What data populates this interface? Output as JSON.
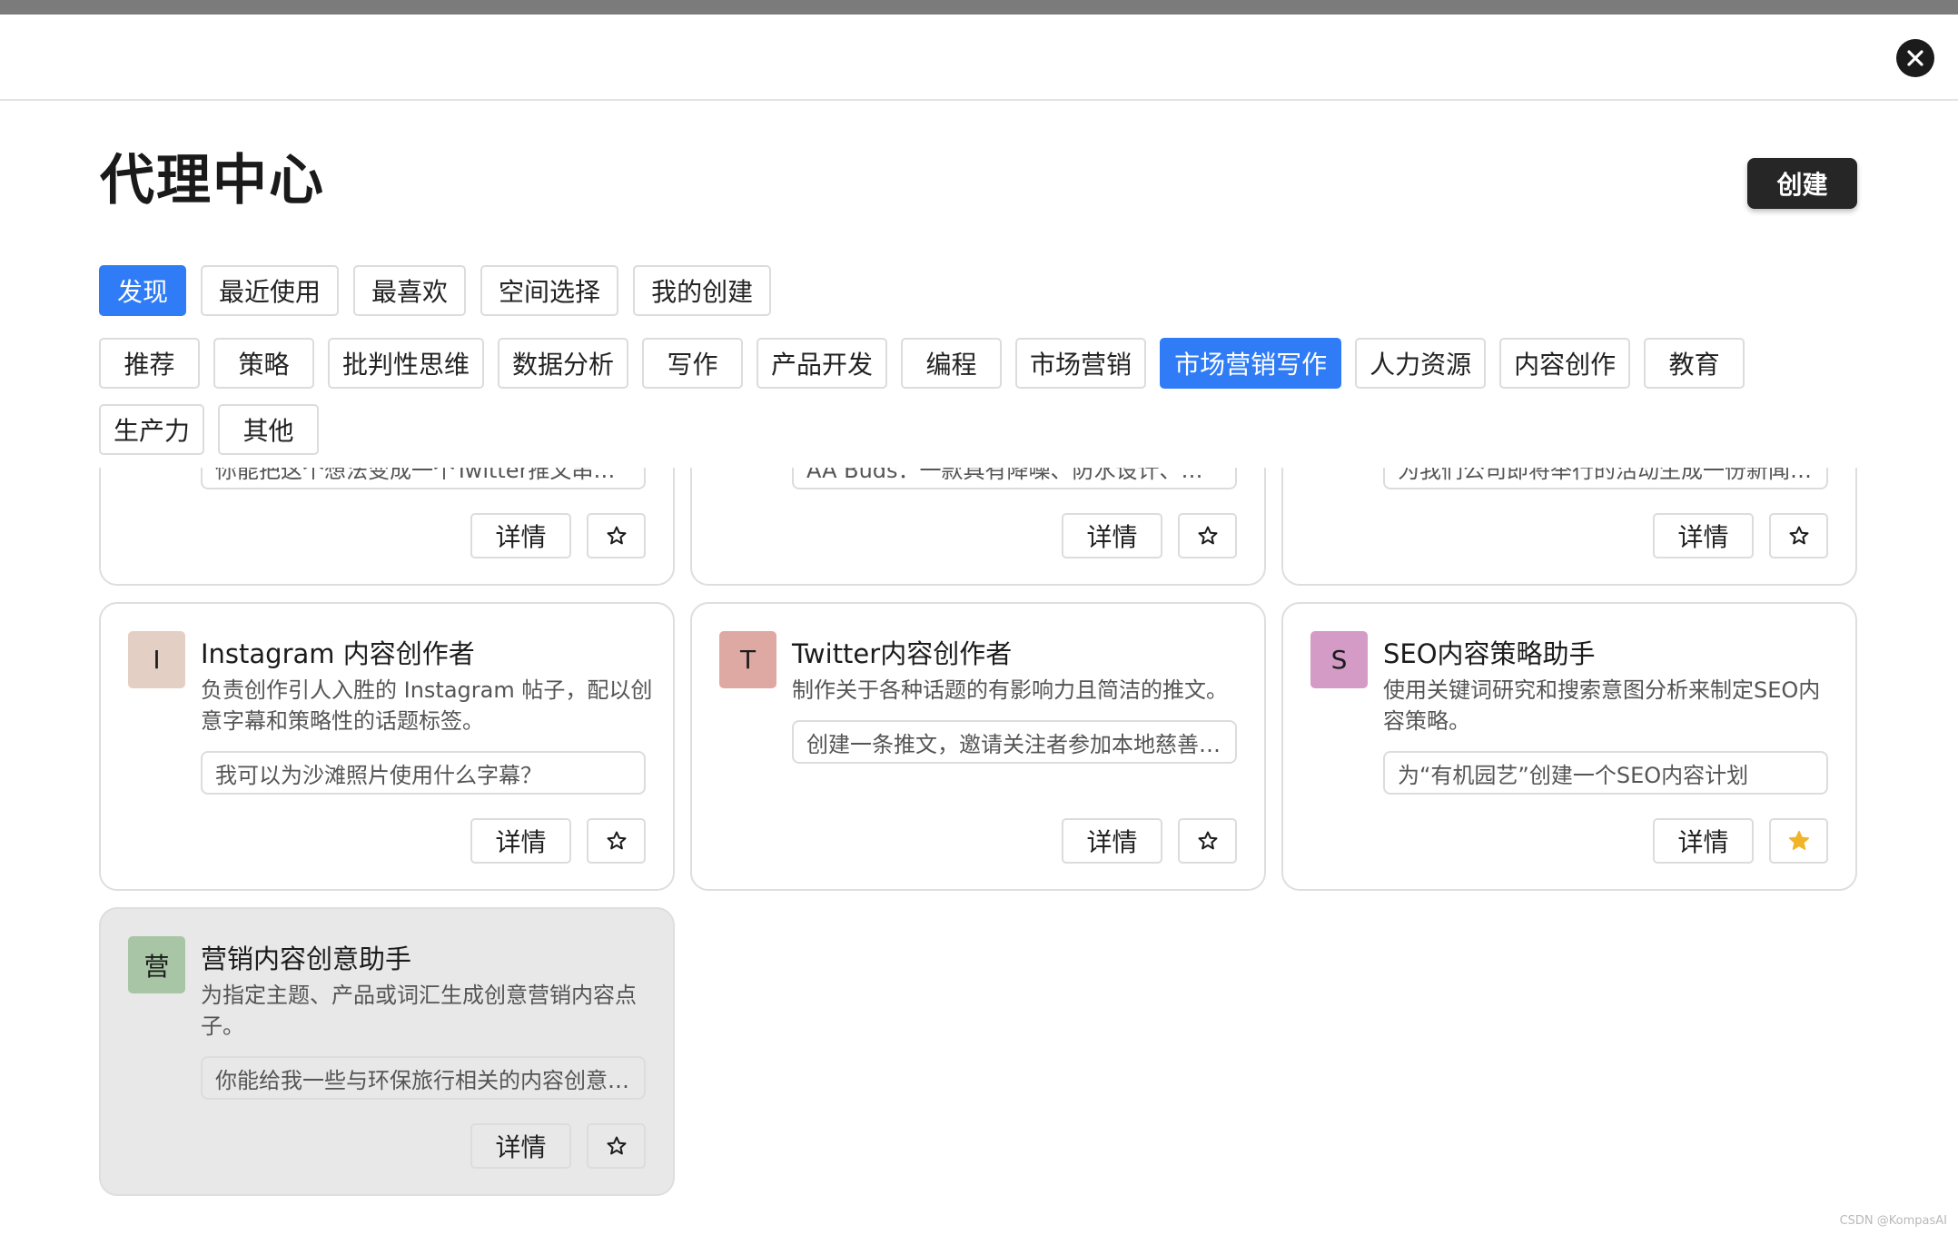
{
  "header": {
    "close_icon": "close-icon"
  },
  "page": {
    "title": "代理中心",
    "create_label": "创建"
  },
  "tabs": [
    {
      "label": "发现",
      "active": true
    },
    {
      "label": "最近使用",
      "active": false
    },
    {
      "label": "最喜欢",
      "active": false
    },
    {
      "label": "空间选择",
      "active": false
    },
    {
      "label": "我的创建",
      "active": false
    }
  ],
  "categories": [
    {
      "label": "推荐",
      "active": false
    },
    {
      "label": "策略",
      "active": false
    },
    {
      "label": "批判性思维",
      "active": false
    },
    {
      "label": "数据分析",
      "active": false
    },
    {
      "label": "写作",
      "active": false
    },
    {
      "label": "产品开发",
      "active": false
    },
    {
      "label": "编程",
      "active": false
    },
    {
      "label": "市场营销",
      "active": false
    },
    {
      "label": "市场营销写作",
      "active": true
    },
    {
      "label": "人力资源",
      "active": false
    },
    {
      "label": "内容创作",
      "active": false
    },
    {
      "label": "教育",
      "active": false
    },
    {
      "label": "生产力",
      "active": false
    },
    {
      "label": "其他",
      "active": false
    }
  ],
  "partial_cards": [
    {
      "prompt": "你能把这个想法变成一个Twitter推文串…",
      "details_label": "详情",
      "starred": false
    },
    {
      "prompt": "AA Buds：一款具有降噪、防水设计、高…",
      "details_label": "详情",
      "starred": false
    },
    {
      "prompt": "为我们公司即将举行的活动生成一份新闻…",
      "details_label": "详情",
      "starred": false
    }
  ],
  "cards": [
    {
      "avatar_letter": "I",
      "avatar_color": "#e3cfc4",
      "title": "Instagram 内容创作者",
      "description": "负责创作引人入胜的 Instagram 帖子，配以创意字幕和策略性的话题标签。",
      "prompt": "我可以为沙滩照片使用什么字幕？",
      "details_label": "详情",
      "starred": false
    },
    {
      "avatar_letter": "T",
      "avatar_color": "#dfa9a3",
      "title": "Twitter内容创作者",
      "description": "制作关于各种话题的有影响力且简洁的推文。",
      "prompt": "创建一条推文，邀请关注者参加本地慈善…",
      "details_label": "详情",
      "starred": false
    },
    {
      "avatar_letter": "S",
      "avatar_color": "#d39bc6",
      "title": "SEO内容策略助手",
      "description": "使用关键词研究和搜索意图分析来制定SEO内容策略。",
      "prompt": "为“有机园艺”创建一个SEO内容计划",
      "details_label": "详情",
      "starred": true
    },
    {
      "avatar_letter": "营",
      "avatar_color": "#a8c5a6",
      "title": "营销内容创意助手",
      "description": "为指定主题、产品或词汇生成创意营销内容点子。",
      "prompt": "你能给我一些与环保旅行相关的内容创意…",
      "details_label": "详情",
      "starred": false
    }
  ],
  "colors": {
    "accent": "#2f7cf6",
    "star_active": "#f0b429"
  },
  "watermark": "CSDN @KompasAI"
}
